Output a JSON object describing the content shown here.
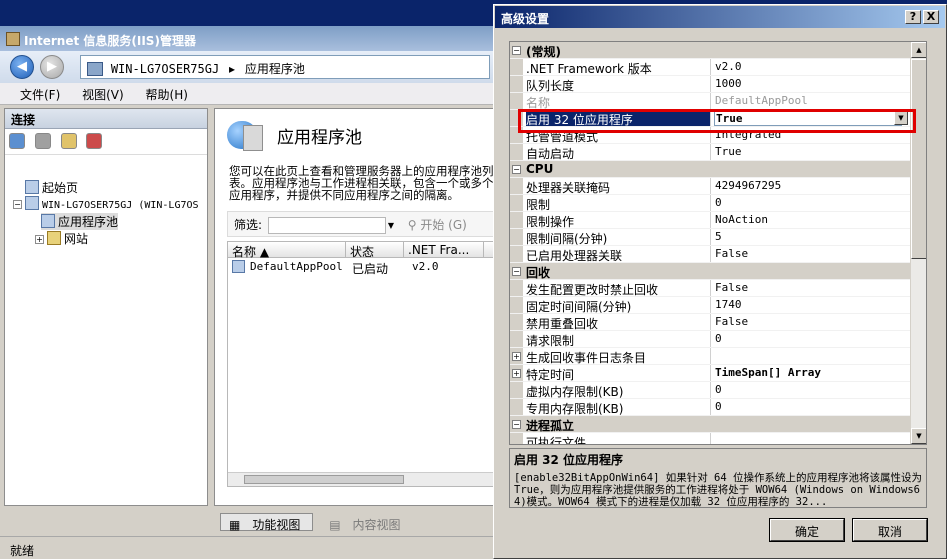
{
  "iis": {
    "title": "Internet 信息服务(IIS)管理器",
    "breadcrumb": [
      "WIN-LG7OSER75GJ",
      "▸",
      "应用程序池"
    ],
    "menu": [
      "文件(F)",
      "视图(V)",
      "帮助(H)"
    ],
    "connections_label": "连接",
    "tree": [
      {
        "label": "起始页"
      },
      {
        "label": "WIN-LG7OSER75GJ (WIN-LG7OS"
      },
      {
        "label": "应用程序池"
      },
      {
        "label": "网站"
      }
    ],
    "page_title": "应用程序池",
    "page_description": "您可以在此页上查看和管理服务器上的应用程序池列表。应用程序池与工作进程相关联，包含一个或多个应用程序，并提供不同应用程序之间的隔离。",
    "filter_label": "筛选:",
    "go_label": "开始 (G)",
    "columns": [
      "名称 ▲",
      "状态",
      ".NET Fra..."
    ],
    "rows": [
      {
        "name": "DefaultAppPool",
        "status": "已启动",
        "framework": "v2.0"
      }
    ],
    "view_tabs": [
      "功能视图",
      "内容视图"
    ],
    "status": "就绪"
  },
  "dialog": {
    "title": "高级设置",
    "help_btn": "?",
    "close_btn": "X",
    "properties": [
      {
        "kind": "cat",
        "name": "(常规)",
        "toggle": "−"
      },
      {
        "kind": "prop",
        "name": ".NET Framework 版本",
        "value": "v2.0"
      },
      {
        "kind": "prop",
        "name": "队列长度",
        "value": "1000"
      },
      {
        "kind": "prop",
        "name": "名称",
        "value": "DefaultAppPool",
        "dim": true
      },
      {
        "kind": "prop",
        "name": "启用 32 位应用程序",
        "value": "True",
        "selected": true
      },
      {
        "kind": "prop",
        "name": "托管管道模式",
        "value": "Integrated"
      },
      {
        "kind": "prop",
        "name": "自动启动",
        "value": "True"
      },
      {
        "kind": "cat",
        "name": "CPU",
        "toggle": "−"
      },
      {
        "kind": "prop",
        "name": "处理器关联掩码",
        "value": "4294967295"
      },
      {
        "kind": "prop",
        "name": "限制",
        "value": "0"
      },
      {
        "kind": "prop",
        "name": "限制操作",
        "value": "NoAction"
      },
      {
        "kind": "prop",
        "name": "限制间隔(分钟)",
        "value": "5"
      },
      {
        "kind": "prop",
        "name": "已启用处理器关联",
        "value": "False"
      },
      {
        "kind": "cat",
        "name": "回收",
        "toggle": "−"
      },
      {
        "kind": "prop",
        "name": "发生配置更改时禁止回收",
        "value": "False"
      },
      {
        "kind": "prop",
        "name": "固定时间间隔(分钟)",
        "value": "1740"
      },
      {
        "kind": "prop",
        "name": "禁用重叠回收",
        "value": "False"
      },
      {
        "kind": "prop",
        "name": "请求限制",
        "value": "0"
      },
      {
        "kind": "prop",
        "name": "生成回收事件日志条目",
        "value": "",
        "toggle": "+"
      },
      {
        "kind": "prop",
        "name": "特定时间",
        "value": "TimeSpan[] Array",
        "toggle": "+",
        "bold": true
      },
      {
        "kind": "prop",
        "name": "虚拟内存限制(KB)",
        "value": "0"
      },
      {
        "kind": "prop",
        "name": "专用内存限制(KB)",
        "value": "0"
      },
      {
        "kind": "cat",
        "name": "进程孤立",
        "toggle": "−"
      },
      {
        "kind": "prop",
        "name": "可执行文件",
        "value": ""
      }
    ],
    "description_title": "启用 32 位应用程序",
    "description_text": "[enable32BitAppOnWin64] 如果针对 64 位操作系统上的应用程序池将该属性设为 True，则为应用程序池提供服务的工作进程将处于 WOW64 (Windows on Windows64)模式。WOW64 模式下的进程是仅加载 32 位应用程序的 32...",
    "ok_label": "确定",
    "cancel_label": "取消"
  }
}
